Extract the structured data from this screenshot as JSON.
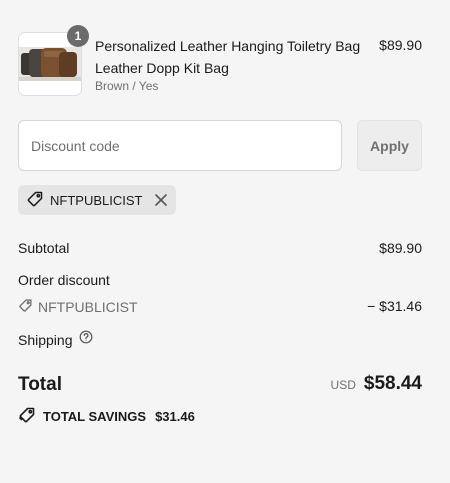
{
  "product": {
    "quantity": "1",
    "name": "Personalized Leather Hanging Toiletry Bag Leather Dopp Kit Bag",
    "variant": "Brown / Yes",
    "price": "$89.90",
    "image_alt": "leather-bags-photo"
  },
  "discount": {
    "placeholder": "Discount code",
    "apply_label": "Apply",
    "applied_code": "NFTPUBLICIST"
  },
  "summary": {
    "subtotal_label": "Subtotal",
    "subtotal_value": "$89.90",
    "order_discount_label": "Order discount",
    "discount_code": "NFTPUBLICIST",
    "discount_value": "− $31.46",
    "shipping_label": "Shipping",
    "total_label": "Total",
    "currency": "USD",
    "total_value": "$58.44",
    "savings_label": "TOTAL SAVINGS",
    "savings_value": "$31.46"
  },
  "colors": {
    "background": "#f5f5f5",
    "text": "#1a1a1a",
    "muted": "#707070",
    "badge": "#6b6b6b"
  }
}
